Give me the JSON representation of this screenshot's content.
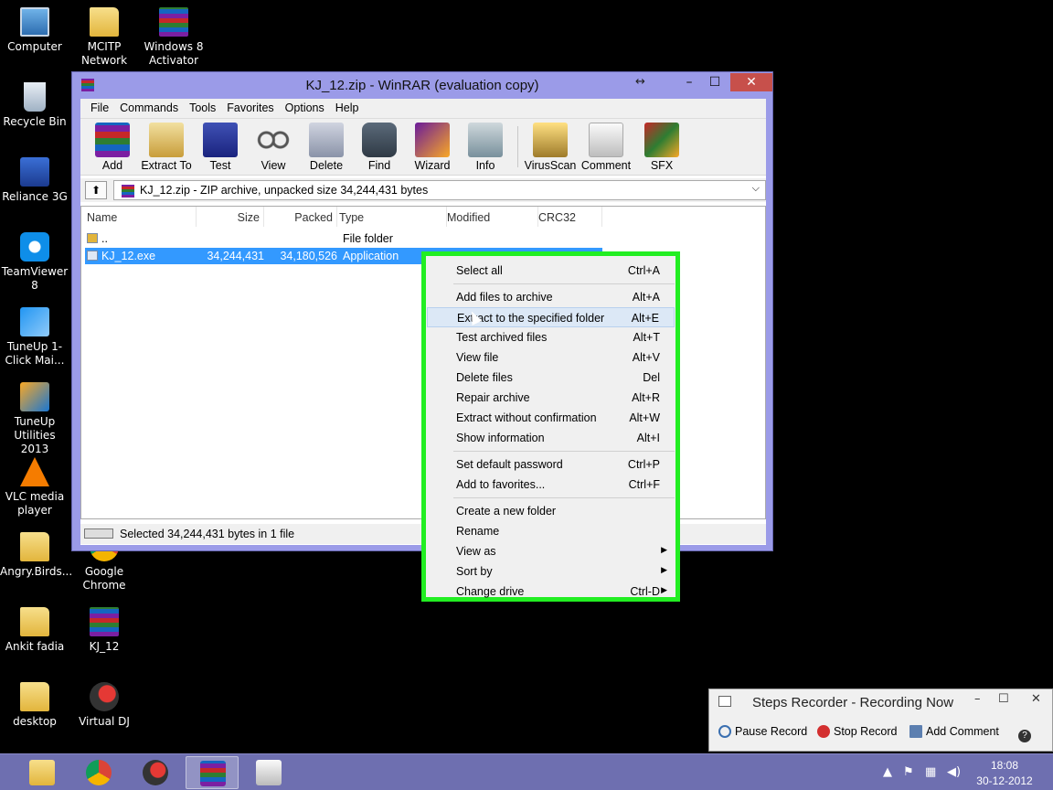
{
  "desktop": {
    "icons": [
      {
        "label": "Computer",
        "icon": "computer-icon"
      },
      {
        "label": "MCITP Network",
        "icon": "folder-icon"
      },
      {
        "label": "Windows 8 Activator",
        "icon": "winrar-archive-icon"
      },
      {
        "label": "Recycle Bin",
        "icon": "recycle-bin-icon"
      },
      {
        "label": "Reliance 3G",
        "icon": "reliance-3g-icon"
      },
      {
        "label": "TeamViewer 8",
        "icon": "teamviewer-icon"
      },
      {
        "label": "TuneUp 1-Click Mai...",
        "icon": "tuneup-icon"
      },
      {
        "label": "TuneUp Utilities 2013",
        "icon": "tuneup-utilities-icon"
      },
      {
        "label": "VLC media player",
        "icon": "vlc-icon"
      },
      {
        "label": "Angry.Birds...",
        "icon": "folder-icon"
      },
      {
        "label": "Google Chrome",
        "icon": "chrome-icon"
      },
      {
        "label": "Ankit fadia",
        "icon": "folder-icon"
      },
      {
        "label": "KJ_12",
        "icon": "winrar-archive-icon"
      },
      {
        "label": "desktop",
        "icon": "folder-icon"
      },
      {
        "label": "Virtual DJ",
        "icon": "virtual-dj-icon"
      }
    ]
  },
  "window": {
    "title": "KJ_12.zip - WinRAR (evaluation copy)",
    "controls": {
      "resize": "↔",
      "minimize": "–",
      "maximize": "☐",
      "close": "✕"
    },
    "menu": [
      "File",
      "Commands",
      "Tools",
      "Favorites",
      "Options",
      "Help"
    ],
    "toolbar": [
      {
        "label": "Add",
        "icon": "add-icon"
      },
      {
        "label": "Extract To",
        "icon": "extract-to-icon"
      },
      {
        "label": "Test",
        "icon": "test-icon"
      },
      {
        "label": "View",
        "icon": "view-icon"
      },
      {
        "label": "Delete",
        "icon": "delete-icon"
      },
      {
        "label": "Find",
        "icon": "find-icon"
      },
      {
        "label": "Wizard",
        "icon": "wizard-icon"
      },
      {
        "label": "Info",
        "icon": "info-icon"
      },
      {
        "label": "VirusScan",
        "icon": "virusscan-icon"
      },
      {
        "label": "Comment",
        "icon": "comment-icon"
      },
      {
        "label": "SFX",
        "icon": "sfx-icon"
      }
    ],
    "address": "KJ_12.zip - ZIP archive, unpacked size 34,244,431 bytes",
    "columns": [
      "Name",
      "Size",
      "Packed",
      "Type",
      "Modified",
      "CRC32"
    ],
    "files": [
      {
        "name": "..",
        "size": "",
        "packed": "",
        "type": "File folder",
        "selected": false
      },
      {
        "name": "KJ_12.exe",
        "size": "34,244,431",
        "packed": "34,180,526",
        "type": "Application",
        "selected": true
      }
    ],
    "status": "Selected 34,244,431 bytes in 1 file"
  },
  "context_menu": {
    "highlight_color": "#22ee22",
    "items": [
      {
        "label": "Select all",
        "key": "Ctrl+A"
      },
      {
        "sep": true
      },
      {
        "label": "Add files to archive",
        "key": "Alt+A"
      },
      {
        "label": "Extract to the specified folder",
        "key": "Alt+E",
        "hover": true
      },
      {
        "label": "Test archived files",
        "key": "Alt+T"
      },
      {
        "label": "View file",
        "key": "Alt+V"
      },
      {
        "label": "Delete files",
        "key": "Del"
      },
      {
        "label": "Repair archive",
        "key": "Alt+R"
      },
      {
        "label": "Extract without confirmation",
        "key": "Alt+W"
      },
      {
        "label": "Show information",
        "key": "Alt+I"
      },
      {
        "sep": true
      },
      {
        "label": "Set default password",
        "key": "Ctrl+P"
      },
      {
        "label": "Add to favorites...",
        "key": "Ctrl+F"
      },
      {
        "sep": true
      },
      {
        "label": "Create a new folder",
        "key": ""
      },
      {
        "label": "Rename",
        "key": ""
      },
      {
        "label": "View as",
        "key": "",
        "submenu": true
      },
      {
        "label": "Sort by",
        "key": "",
        "submenu": true
      },
      {
        "label": "Change drive",
        "key": "Ctrl-D",
        "submenu": true
      }
    ]
  },
  "steps_recorder": {
    "title": "Steps Recorder - Recording Now",
    "pause": "Pause Record",
    "stop": "Stop Record",
    "add_comment": "Add Comment",
    "help": "?"
  },
  "taskbar": {
    "apps": [
      {
        "name": "file-explorer-icon",
        "active": false
      },
      {
        "name": "chrome-icon",
        "active": false
      },
      {
        "name": "virtual-dj-icon",
        "active": false
      },
      {
        "name": "winrar-icon",
        "active": true
      },
      {
        "name": "steps-recorder-icon",
        "active": false
      }
    ],
    "time": "18:08",
    "date": "30-12-2012"
  }
}
